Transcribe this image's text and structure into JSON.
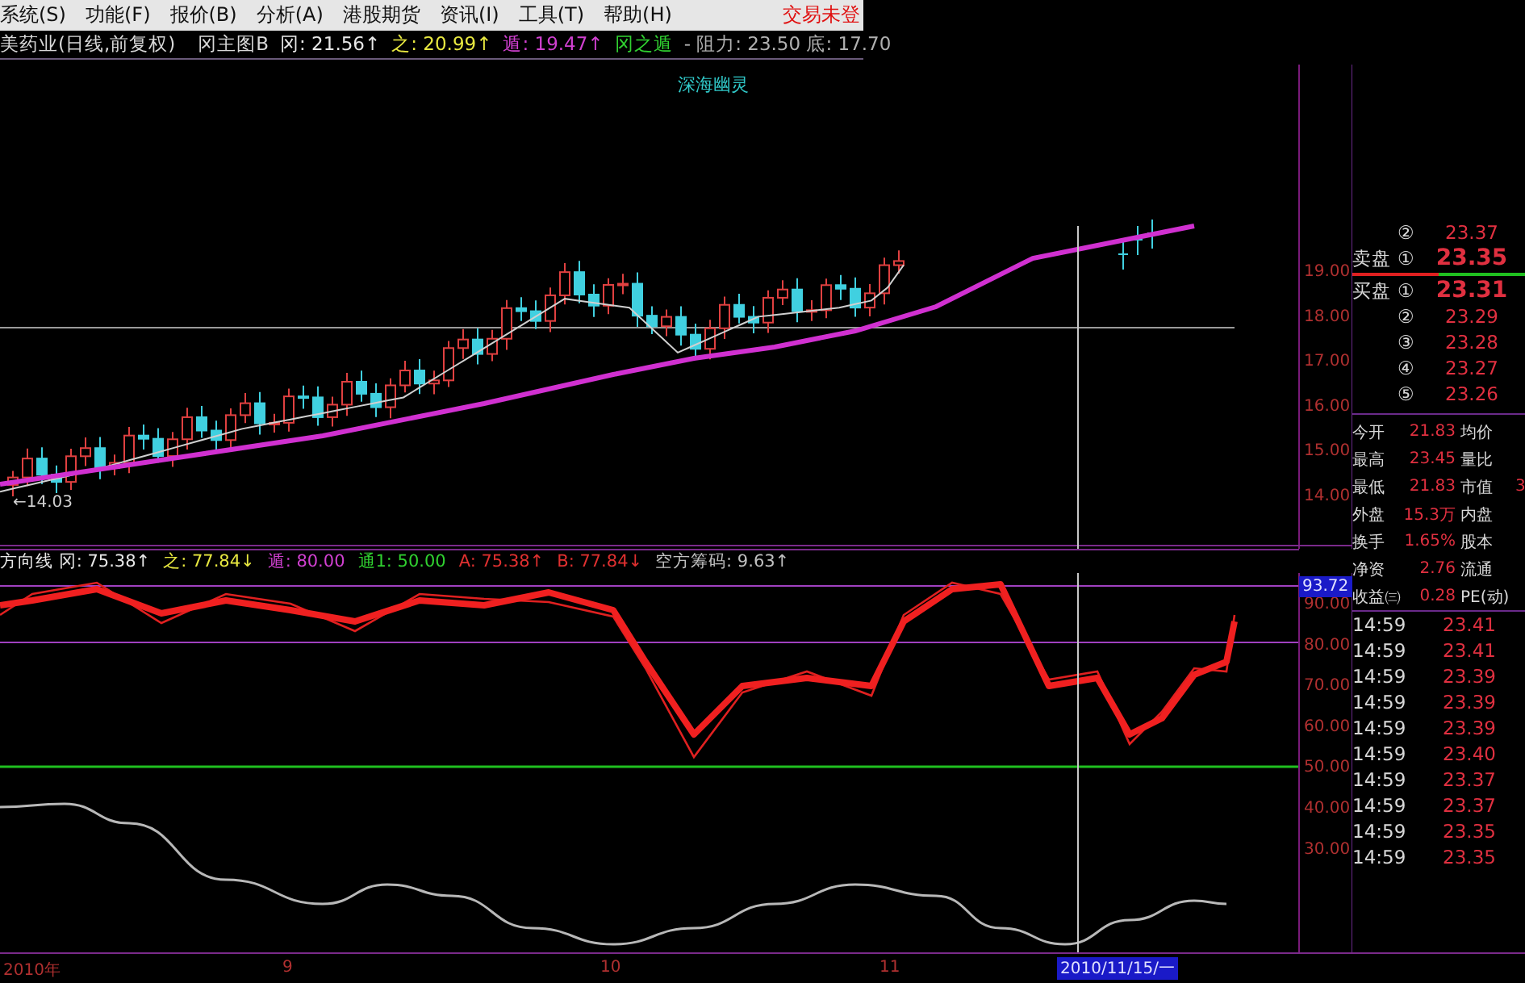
{
  "menu_bar": {
    "items": [
      "系统(S)",
      "功能(F)",
      "报价(B)",
      "分析(A)",
      "港股期货",
      "资讯(I)",
      "工具(T)",
      "帮助(H)"
    ],
    "status": "交易未登"
  },
  "info_line": {
    "security": "美药业(日线,前复权)",
    "items": [
      {
        "text": "冈主图B",
        "color": "#d8d8d8"
      },
      {
        "text": "冈: 21.56↑",
        "color": "#e8e8e8"
      },
      {
        "text": "之: 20.99↑",
        "color": "#e8e840"
      },
      {
        "text": "遁: 19.47↑",
        "color": "#d040d0"
      },
      {
        "text": "冈之遁",
        "color": "#30d030"
      },
      {
        "text": "- 阻力: 23.50 底: 17.70",
        "color": "#b0b0b0"
      }
    ]
  },
  "main_chart": {
    "label": "深海幽灵",
    "low_marker": "←14.03",
    "y_axis": [
      "19.00",
      "18.00",
      "17.00",
      "16.00",
      "15.00",
      "14.00"
    ]
  },
  "indicator": {
    "header": [
      {
        "text": "方向线 冈: 75.38↑",
        "color": "#e8e8e8"
      },
      {
        "text": "之: 77.84↓",
        "color": "#e8e840"
      },
      {
        "text": "遁: 80.00",
        "color": "#d040d0"
      },
      {
        "text": "通1: 50.00",
        "color": "#30d030"
      },
      {
        "text": "A: 75.38↑",
        "color": "#e03030"
      },
      {
        "text": "B: 77.84↓",
        "color": "#e03030"
      },
      {
        "text": "空方筹码: 9.63↑",
        "color": "#c0c0c0"
      }
    ],
    "current_value": "93.72",
    "y_axis": [
      "90.00",
      "80.00",
      "70.00",
      "60.00",
      "50.00",
      "40.00",
      "30.00"
    ]
  },
  "time_axis": {
    "labels": [
      "2010年",
      "9",
      "10",
      "11"
    ],
    "cursor_date": "2010/11/15/一"
  },
  "order_book": [
    {
      "rank": "②",
      "price": "23.37",
      "best": false
    },
    {
      "side": "卖盘",
      "rank": "①",
      "price": "23.35",
      "best": true
    },
    {
      "side": "买盘",
      "rank": "①",
      "price": "23.31",
      "best": true
    },
    {
      "rank": "②",
      "price": "23.29",
      "best": false
    },
    {
      "rank": "③",
      "price": "23.28",
      "best": false
    },
    {
      "rank": "④",
      "price": "23.27",
      "best": false
    },
    {
      "rank": "⑤",
      "price": "23.26",
      "best": false
    }
  ],
  "quote_stats": [
    {
      "label": "今开",
      "value": "21.83",
      "label_2": "均价"
    },
    {
      "label": "最高",
      "value": "23.45",
      "label_2": "量比"
    },
    {
      "label": "最低",
      "value": "21.83",
      "label_2": "市值",
      "value_2": "3"
    },
    {
      "label": "外盘",
      "value": "15.3万",
      "label_2": "内盘"
    },
    {
      "label": "换手",
      "value": "1.65%",
      "label_2": "股本"
    },
    {
      "label": "净资",
      "value": "2.76",
      "label_2": "流通"
    },
    {
      "label": "收益㈢",
      "value": "0.28",
      "label_2": "PE(动)"
    }
  ],
  "ticks": [
    {
      "time": "14:59",
      "price": "23.41"
    },
    {
      "time": "14:59",
      "price": "23.41"
    },
    {
      "time": "14:59",
      "price": "23.39"
    },
    {
      "time": "14:59",
      "price": "23.39"
    },
    {
      "time": "14:59",
      "price": "23.39"
    },
    {
      "time": "14:59",
      "price": "23.40"
    },
    {
      "time": "14:59",
      "price": "23.37"
    },
    {
      "time": "14:59",
      "price": "23.37"
    },
    {
      "time": "14:59",
      "price": "23.35"
    },
    {
      "time": "14:59",
      "price": "23.35"
    }
  ]
}
